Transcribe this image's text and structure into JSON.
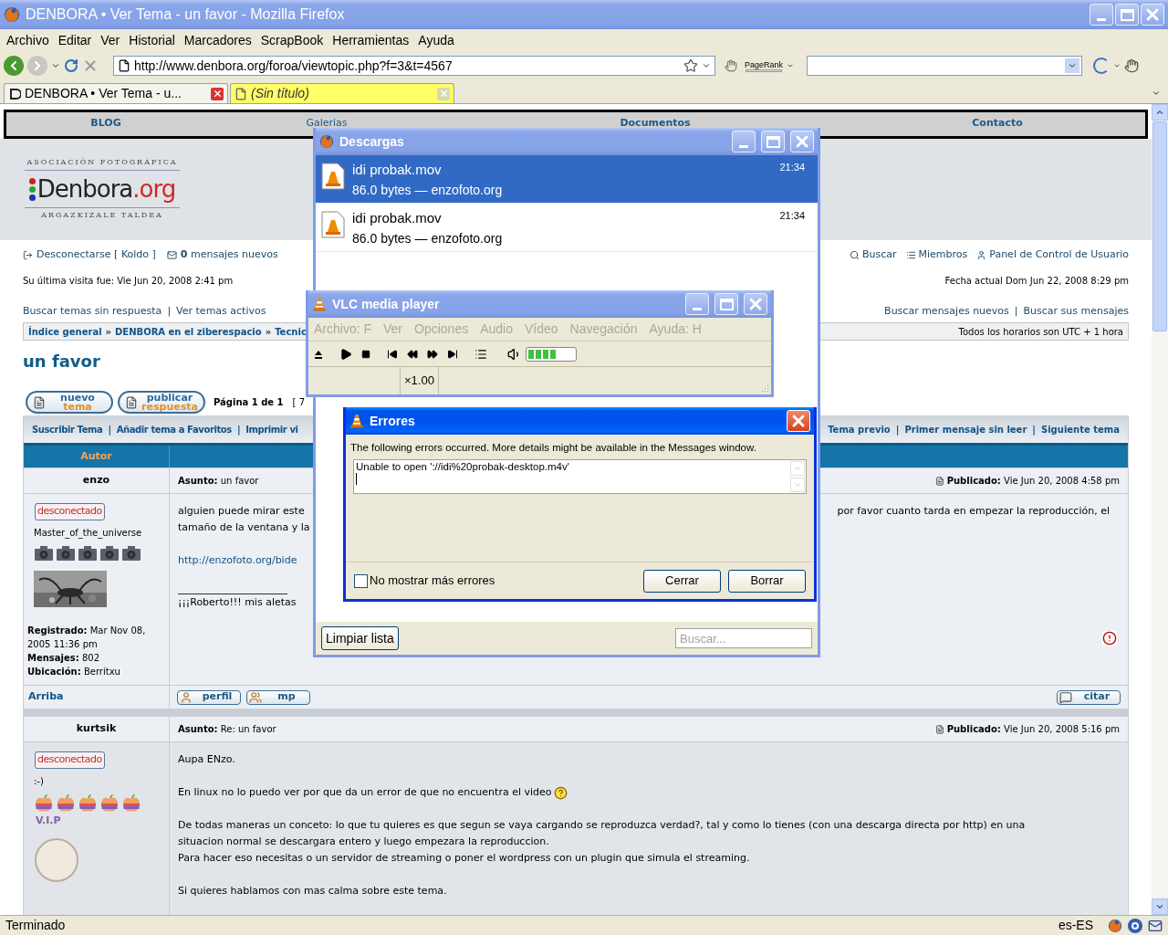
{
  "window": {
    "title": "DENBORA • Ver Tema - un favor - Mozilla Firefox",
    "active": false
  },
  "menu": [
    "Archivo",
    "Editar",
    "Ver",
    "Historial",
    "Marcadores",
    "ScrapBook",
    "Herramientas",
    "Ayuda"
  ],
  "toolbar": {
    "url": "http://www.denbora.org/foroa/viewtopic.php?f=3&t=4567",
    "pagerank_label": "PageRank"
  },
  "tabs": [
    {
      "label": "DENBORA • Ver Tema - u...",
      "selected": true
    },
    {
      "label": "(Sin título)",
      "selected": false
    }
  ],
  "site_nav": [
    "BLOG",
    "Galerias",
    "Documentos",
    "Contacto"
  ],
  "logo": {
    "top": "ASOCIACIÓN FOTOGRÁFICA",
    "name": "Denbora",
    "tld": ".org",
    "bottom": "ARGAZKIZALE TALDEA"
  },
  "logout": "Desconectarse [ Koldo ]",
  "new_messages": {
    "count": "0",
    "text": "mensajes nuevos"
  },
  "user_links_right": [
    {
      "label": "Buscar",
      "kind": "search"
    },
    {
      "label": "Miembros",
      "kind": "members"
    },
    {
      "label": "Panel de Control de Usuario",
      "kind": "user"
    }
  ],
  "last_visit": "Su última visita fue: Vie Jun 20, 2008 2:41 pm",
  "current_date": "Fecha actual Dom Jun 22, 2008 8:29 pm",
  "link_separator": "|",
  "search_links_left": [
    "Buscar temas sin respuesta",
    "Ver temas activos"
  ],
  "search_links_right": [
    "Buscar mensajes nuevos",
    "Buscar sus mensajes"
  ],
  "breadcrumb_separator": "»",
  "breadcrumb": [
    "Índice general",
    "DENBORA en el ziberespacio",
    "Tecnic"
  ],
  "timezone": "Todos los horarios son UTC + 1 hora",
  "topic_title": "un favor",
  "action_buttons": [
    {
      "top": "nuevo",
      "bottom": "tema"
    },
    {
      "top": "publicar",
      "bottom": "respuesta"
    }
  ],
  "pagination": "Página 1 de 1",
  "pagination_rest": "[ 7",
  "topic_links_left": [
    "Suscribir Tema",
    "Añadir tema a Favoritos",
    "Imprimir vi"
  ],
  "topic_links_right": [
    "Tema previo",
    "Primer mensaje sin leer",
    "Siguiente tema"
  ],
  "table_header": "Autor",
  "posts": [
    {
      "author": "enzo",
      "subject_label": "Asunto:",
      "subject": "un favor",
      "posted_label": "Publicado:",
      "posted": "Vie Jun 20, 2008 4:58 pm",
      "status": "desconectado",
      "rank": "Master_of_the_universe",
      "rank_badge": {
        "kind": "camera",
        "stars": 5
      },
      "avatar": {
        "kind": "picture"
      },
      "info": [
        {
          "label": "Registrado:",
          "value": "Mar Nov 08, 2005 11:36 pm"
        },
        {
          "label": "Mensajes:",
          "value": "802"
        },
        {
          "label": "Ubicación:",
          "value": "Berritxu"
        }
      ],
      "body": [
        {
          "kind": "text",
          "text": "alguien puede mirar este",
          "right": "por favor cuanto tarda en empezar la reproducción, el"
        },
        {
          "kind": "text",
          "text": "tamaño de la ventana y la"
        },
        {
          "kind": "gap"
        },
        {
          "kind": "link",
          "text": "http://enzofoto.org/bide"
        },
        {
          "kind": "gap"
        },
        {
          "kind": "rule"
        },
        {
          "kind": "text",
          "text": "¡¡¡Roberto!!! mis aletas"
        }
      ],
      "reportable": true,
      "top_link": "Arriba",
      "footer_left": [
        {
          "label": "perfil",
          "kind": "profile"
        },
        {
          "label": "mp",
          "kind": "pm"
        }
      ],
      "footer_right": [
        {
          "label": "citar",
          "kind": "quote"
        }
      ]
    },
    {
      "author": "kurtsik",
      "subject_label": "Asunto:",
      "subject": "Re: un favor",
      "posted_label": "Publicado:",
      "posted": "Vie Jun 20, 2008 5:16 pm",
      "status": "desconectado",
      "rank": ":-)",
      "rank_badge": {
        "kind": "apple",
        "stars": 5
      },
      "rank_title": "V.I.P",
      "avatar": {
        "kind": "avatar"
      },
      "body": [
        {
          "kind": "text",
          "text": "Aupa ENzo."
        },
        {
          "kind": "gap"
        },
        {
          "kind": "text_emoticon",
          "text": "En linux no lo puedo ver por que da un error de que no encuentra el video"
        },
        {
          "kind": "gap"
        },
        {
          "kind": "text",
          "text": "De todas maneras un conceto: lo que tu quieres es que segun se vaya cargando se reproduzca verdad?, tal y como lo tienes (con una descarga directa por http) en una"
        },
        {
          "kind": "text",
          "text": "situacion normal se descargara entero y luego empezara la reproduccion."
        },
        {
          "kind": "text",
          "text": "Para hacer eso necesitas o un servidor de streaming o poner el wordpress con un plugin que simula el streaming."
        },
        {
          "kind": "gap"
        },
        {
          "kind": "text",
          "text": "Si quieres hablamos con mas calma sobre este tema."
        }
      ]
    }
  ],
  "status_bar": {
    "text": "Terminado",
    "locale": "es-ES"
  },
  "downloads": {
    "title": "Descargas",
    "active": false,
    "items": [
      {
        "name": "idi probak.mov",
        "info": "86.0 bytes — enzofoto.org",
        "time": "21:34",
        "selected": true
      },
      {
        "name": "idi probak.mov",
        "info": "86.0 bytes — enzofoto.org",
        "time": "21:34",
        "selected": false
      }
    ],
    "clear_button": "Limpiar lista",
    "search_placeholder": "Buscar..."
  },
  "vlc": {
    "title": "VLC media player",
    "active": false,
    "menu_disabled": true,
    "menu": [
      "Archivo: F",
      "Ver",
      "Opciones",
      "Audio",
      "Vídeo",
      "Navegación",
      "Ayuda: H"
    ],
    "volume": {
      "level": 0.6
    },
    "speed": "×1.00"
  },
  "errors": {
    "title": "Errores",
    "active": true,
    "message": "The following errors occurred. More details might be available in the Messages window.",
    "log": "Unable to open '://idi%20probak-desktop.m4v'",
    "dont_show": {
      "label": "No mostrar más errores",
      "checked": false
    },
    "buttons": [
      "Cerrar",
      "Borrar"
    ]
  }
}
